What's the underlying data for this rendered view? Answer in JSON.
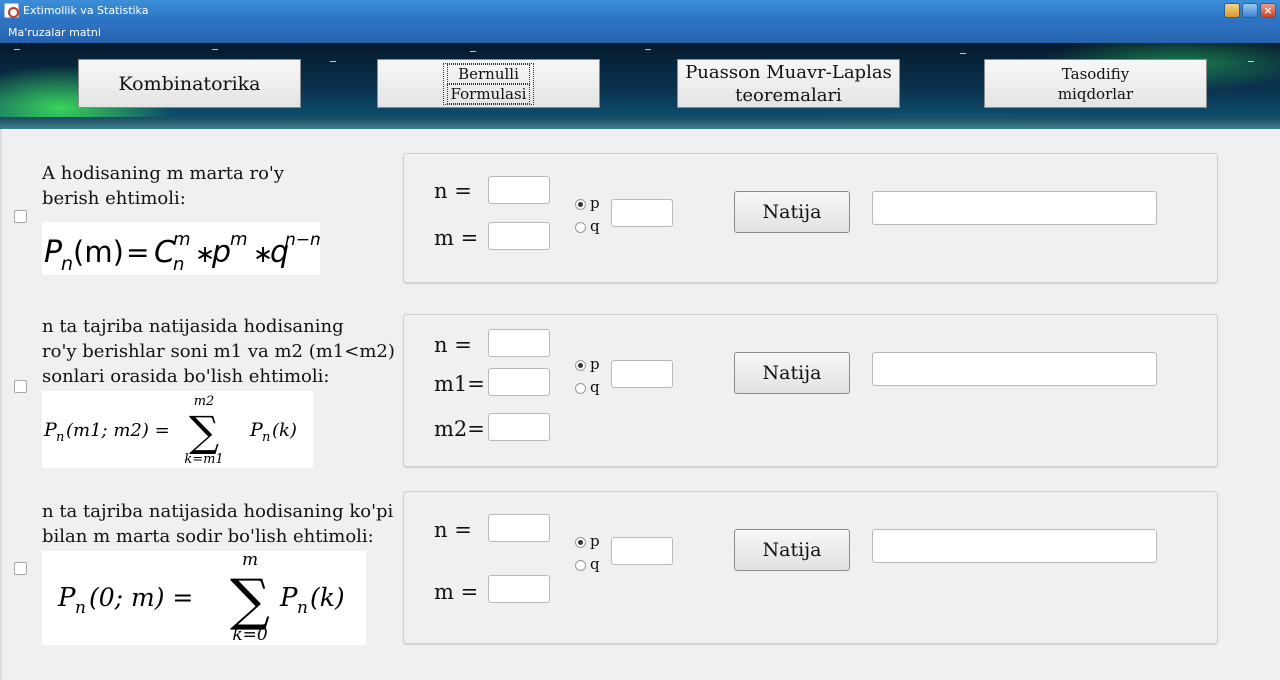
{
  "window": {
    "title": "Extimollik va Statistika",
    "controls": [
      "minimize-icon",
      "maximize-icon",
      "close-icon"
    ]
  },
  "menu": {
    "items": [
      "Ma'ruzalar matni"
    ]
  },
  "nav": {
    "kombinatorika": "Kombinatorika",
    "bernulli_line1": "Bernulli",
    "bernulli_line2": "Formulasi",
    "puasson_line1": "Puasson Muavr-Laplas",
    "puasson_line2": "teoremalari",
    "tasodifiy_line1": "Tasodifiy",
    "tasodifiy_line2": "miqdorlar"
  },
  "sections": [
    {
      "desc_lines": [
        "A hodisaning m marta ro'y",
        "berish ehtimoli:"
      ],
      "formula": {
        "P": "P",
        "n": "n",
        "m": "(m)",
        "eq": "=",
        "C": "C",
        "C_sup": "m",
        "C_sub": "n",
        "mul1": "∗",
        "p": "p",
        "p_sup": "m",
        "mul2": "∗",
        "q": "q",
        "q_sup": "n−m"
      },
      "labels": {
        "n": "n =",
        "m": "m ="
      },
      "radio": {
        "p": "p",
        "q": "q",
        "selected": "p"
      },
      "button": "Natija",
      "values": {
        "n": "",
        "m": "",
        "prob": "",
        "result": ""
      }
    },
    {
      "desc_lines": [
        "n ta tajriba natijasida hodisaning",
        "ro'y berishlar soni m1 va m2 (m1<m2)",
        "sonlari orasida bo'lish ehtimoli:"
      ],
      "formula": {
        "lhs_P": "P",
        "lhs_sub": "n",
        "lhs_args": "(m1; m2) =",
        "sigma": "∑",
        "top": "m2",
        "bottom": "k=m1",
        "rhs_P": "P",
        "rhs_sub": "n",
        "rhs_args": "(k)"
      },
      "labels": {
        "n": "n =",
        "m1": "m1=",
        "m2": "m2="
      },
      "radio": {
        "p": "p",
        "q": "q",
        "selected": "p"
      },
      "button": "Natija",
      "values": {
        "n": "",
        "m1": "",
        "m2": "",
        "prob": "",
        "result": ""
      }
    },
    {
      "desc_lines": [
        "n ta tajriba natijasida hodisaning ko'pi",
        "bilan m marta sodir bo'lish ehtimoli:"
      ],
      "formula": {
        "lhs_P": "P",
        "lhs_sub": "n",
        "lhs_args": "(0; m) =",
        "sigma": "∑",
        "top": "m",
        "bottom": "k=0",
        "rhs_P": "P",
        "rhs_sub": "n",
        "rhs_args": "(k)"
      },
      "labels": {
        "n": "n =",
        "m": "m ="
      },
      "radio": {
        "p": "p",
        "q": "q",
        "selected": "p"
      },
      "button": "Natija",
      "values": {
        "n": "",
        "m": "",
        "prob": "",
        "result": ""
      }
    }
  ]
}
